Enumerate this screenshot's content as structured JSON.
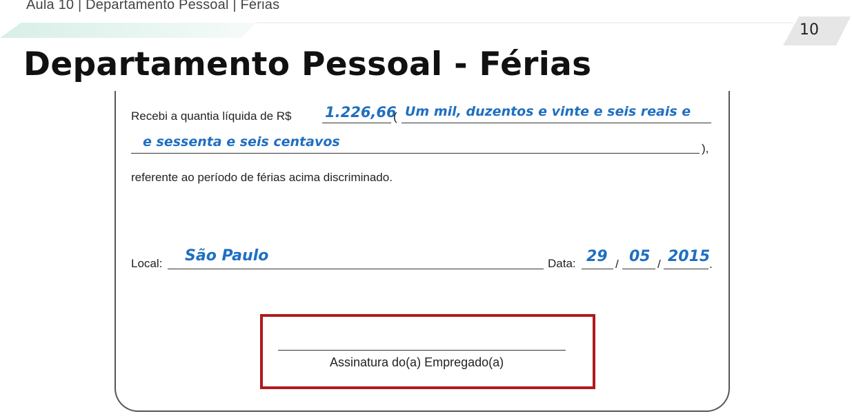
{
  "header": {
    "breadcrumb": "Aula 10 | Departamento Pessoal | Férias",
    "page_number": "10"
  },
  "slide": {
    "title": "Departamento Pessoal - Férias"
  },
  "receipt": {
    "received_label": "Recebi a quantia líquida de R$",
    "amount": "1.226,66",
    "open_paren": "(",
    "amount_words_line1": "Um mil, duzentos e vinte e seis reais e",
    "amount_words_line2": "e sessenta e seis centavos",
    "close_paren": "),",
    "reference_text": "referente ao período de férias acima discriminado.",
    "local_label": "Local:",
    "local_value": "São Paulo",
    "date_label": "Data:",
    "date_day": "29",
    "date_month": "05",
    "date_year": "2015",
    "date_sep": "/",
    "date_end": ".",
    "signature_label": "Assinatura do(a) Empregado(a)"
  },
  "colors": {
    "handwritten_fill": "#1f6fc1",
    "highlight_box": "#b1191d"
  }
}
